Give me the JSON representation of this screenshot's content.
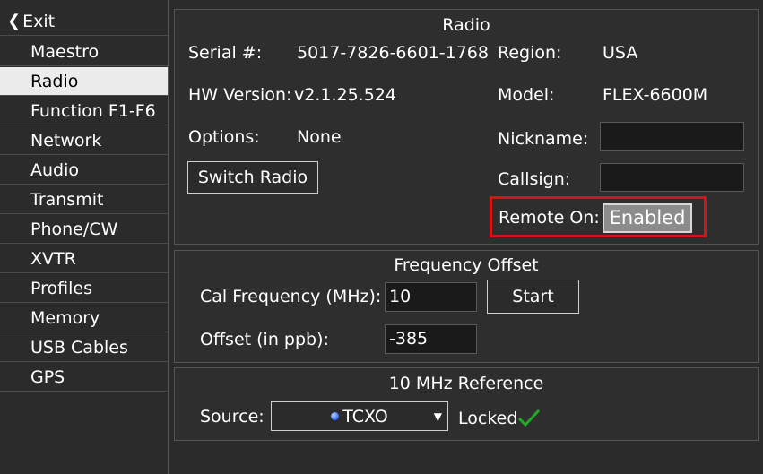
{
  "sidebar": {
    "exit_label": "Exit",
    "items": [
      {
        "label": "Maestro"
      },
      {
        "label": "Radio"
      },
      {
        "label": "Function F1-F6"
      },
      {
        "label": "Network"
      },
      {
        "label": "Audio"
      },
      {
        "label": "Transmit"
      },
      {
        "label": "Phone/CW"
      },
      {
        "label": "XVTR"
      },
      {
        "label": "Profiles"
      },
      {
        "label": "Memory"
      },
      {
        "label": "USB Cables"
      },
      {
        "label": "GPS"
      }
    ],
    "active": "Radio"
  },
  "radio": {
    "title": "Radio",
    "serial_label": "Serial #:",
    "serial_value": "5017-7826-6601-1768",
    "region_label": "Region:",
    "region_value": "USA",
    "hw_label": "HW Version:",
    "hw_value": "v2.1.25.524",
    "model_label": "Model:",
    "model_value": "FLEX-6600M",
    "options_label": "Options:",
    "options_value": "None",
    "nickname_label": "Nickname:",
    "nickname_value": "",
    "switch_button": "Switch Radio",
    "callsign_label": "Callsign:",
    "callsign_value": "",
    "remote_label": "Remote On:",
    "remote_value": "Enabled"
  },
  "frequency_offset": {
    "title": "Frequency Offset",
    "cal_label": "Cal Frequency (MHz):",
    "cal_value": "10",
    "start_button": "Start",
    "offset_label": "Offset (in ppb):",
    "offset_value": "-385"
  },
  "reference": {
    "title": "10 MHz Reference",
    "source_label": "Source:",
    "source_value": "TCXO",
    "status": "Locked"
  },
  "colors": {
    "highlight_border": "#d41515",
    "active_item_bg": "#ececec",
    "locked_check": "#22aa22"
  }
}
